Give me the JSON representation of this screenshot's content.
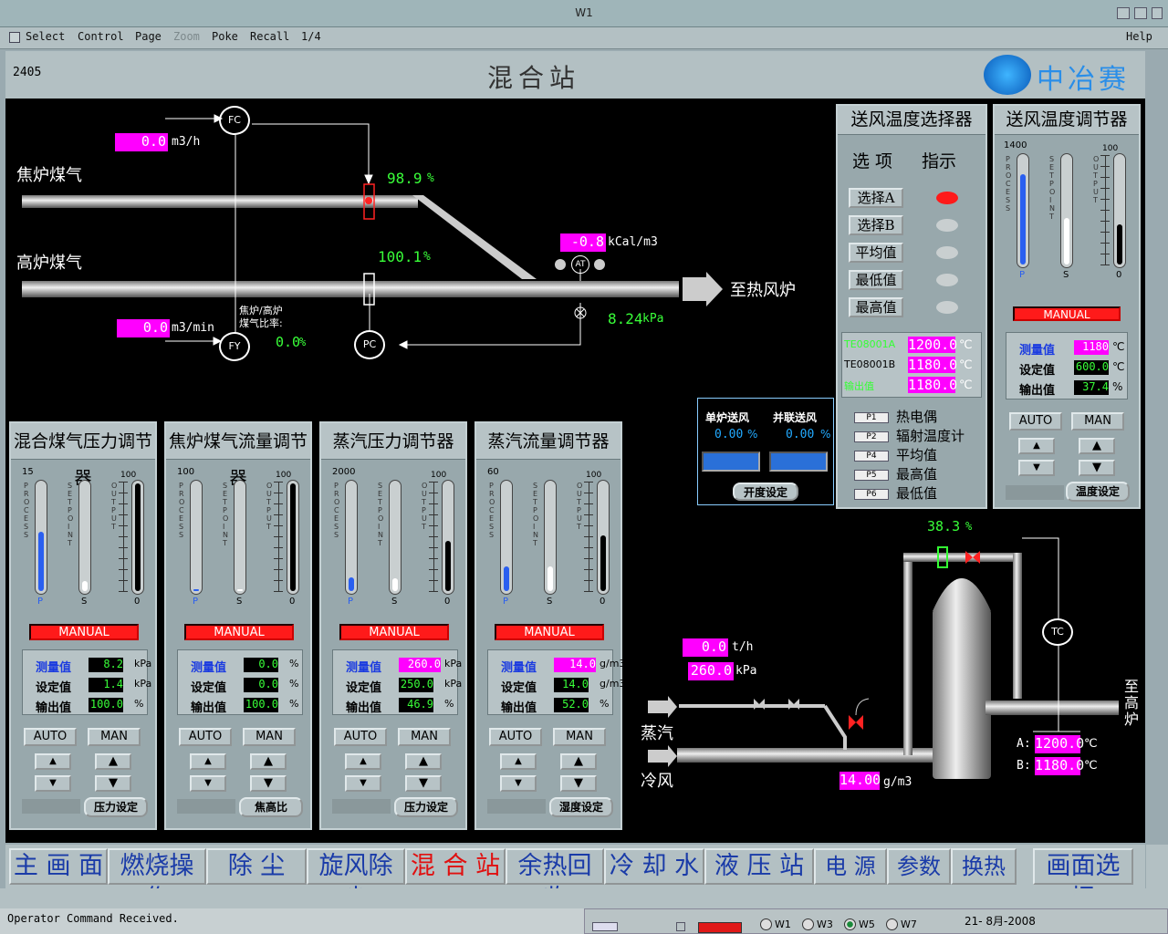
{
  "window": {
    "title": "W1"
  },
  "menu": {
    "items": [
      "Select",
      "Control",
      "Page",
      "Zoom",
      "Poke",
      "Recall",
      "1/4"
    ],
    "help": "Help"
  },
  "header": {
    "id": "2405",
    "title": "混合站",
    "logo": "中冶赛迪"
  },
  "process": {
    "coke_gas": "焦炉煤气",
    "bf_gas": "高炉煤气",
    "to_stove": "至热风炉",
    "fc_flow": "0.0",
    "fc_unit": "m3/h",
    "fc_tag": "FC",
    "valve1_pct": "98.9",
    "valve2_pct": "100.1",
    "pct": "%",
    "heat": "-0.8",
    "heat_unit": "kCal/m3",
    "at_tag": "AT",
    "pressure": "8.24",
    "pressure_unit": "kPa",
    "fy_flow": "0.0",
    "fy_unit": "m3/min",
    "fy_tag": "FY",
    "pc_tag": "PC",
    "ratio_label1": "焦炉/高炉",
    "ratio_label2": "煤气比率:",
    "ratio": "0.0",
    "ratio_unit": "%",
    "steam_valve": "38.3",
    "steam_flow": "0.0",
    "steam_flow_unit": "t/h",
    "steam_press": "260.0",
    "steam_press_unit": "kPa",
    "steam": "蒸汽",
    "cold_air": "冷风",
    "humidity": "14.00",
    "humidity_unit": "g/m3",
    "tc_tag": "TC",
    "a_label": "A:",
    "a_temp": "1200.0",
    "b_label": "B:",
    "b_temp": "1180.0",
    "deg": "℃",
    "to_bf": "至高炉"
  },
  "selector": {
    "title": "送风温度选择器",
    "col1": "选 项",
    "col2": "指示",
    "options": [
      "选择A",
      "选择B",
      "平均值",
      "最低值",
      "最高值"
    ],
    "te": [
      {
        "tag": "TE08001A",
        "val": "1200.0"
      },
      {
        "tag": "TE08001B",
        "val": "1180.0"
      },
      {
        "tag": "输出值",
        "val": "1180.0"
      }
    ],
    "deg": "℃",
    "sensors": [
      {
        "k": "P1",
        "v": "热电偶"
      },
      {
        "k": "P2",
        "v": "辐射温度计"
      },
      {
        "k": "P4",
        "v": "平均值"
      },
      {
        "k": "P5",
        "v": "最高值"
      },
      {
        "k": "P6",
        "v": "最低值"
      }
    ]
  },
  "blower": {
    "single": "单炉送风",
    "parallel": "并联送风",
    "single_val": "0.00",
    "parallel_val": "0.00",
    "pct": "%",
    "open_set": "开度设定"
  },
  "controllers": [
    {
      "title": "混合煤气压力调节器",
      "scale": "15",
      "pv": "8.2",
      "sv": "1.4",
      "out": "100.0",
      "unit": "kPa",
      "set": "压力设定",
      "pfill": 0.55,
      "sfill": 0.09,
      "ofill": 1.0,
      "pv_mag": false
    },
    {
      "title": "焦炉煤气流量调节器",
      "scale": "100",
      "pv": "0.0",
      "sv": "0.0",
      "out": "100.0",
      "unit": "%",
      "set": "焦高比",
      "pfill": 0.02,
      "sfill": 0.02,
      "ofill": 1.0,
      "pv_mag": false
    },
    {
      "title": "蒸汽压力调节器",
      "scale": "2000",
      "pv": "260.0",
      "sv": "250.0",
      "out": "46.9",
      "unit": "kPa",
      "set": "压力设定",
      "pfill": 0.13,
      "sfill": 0.12,
      "ofill": 0.47,
      "pv_mag": true
    },
    {
      "title": "蒸汽流量调节器",
      "scale": "60",
      "pv": "14.0",
      "sv": "14.0",
      "out": "52.0",
      "unit": "g/m3",
      "set": "湿度设定",
      "pfill": 0.23,
      "sfill": 0.23,
      "ofill": 0.52,
      "pv_mag": true
    }
  ],
  "temp_ctrl": {
    "title": "送风温度调节器",
    "scale": "1400",
    "pv": "1180",
    "sv": "600.0",
    "out": "37.4",
    "unit": "℃",
    "pct": "%",
    "set": "温度设定",
    "pfill": 0.84,
    "sfill": 0.43,
    "ofill": 0.37
  },
  "common": {
    "process": "PROCESS",
    "setpoint": "SETPOINT",
    "output": "OUTPUT",
    "manual": "MANUAL",
    "auto": "AUTO",
    "man": "MAN",
    "pv_label": "测量值",
    "sv_label": "设定值",
    "out_label": "输出值",
    "out_scale": "100",
    "p": "P",
    "s": "S",
    "zero": "0"
  },
  "nav": [
    "主 画 面",
    "燃烧操作",
    "除 尘",
    "旋风除尘",
    "混 合 站",
    "余热回收",
    "冷 却 水",
    "液 压 站",
    "电 源",
    "参数",
    "换热器",
    "画面选择"
  ],
  "status": {
    "message": "Operator Command Received.",
    "radios": [
      "W1",
      "W3",
      "W5",
      "W7"
    ],
    "date": "21- 8月-2008"
  },
  "colors": {
    "accent_magenta": "#ff00ff",
    "value_green": "#39ff39",
    "alarm_red": "#ff1a1a",
    "nav_text": "#1a3ba8",
    "nav_active": "#e01010"
  }
}
